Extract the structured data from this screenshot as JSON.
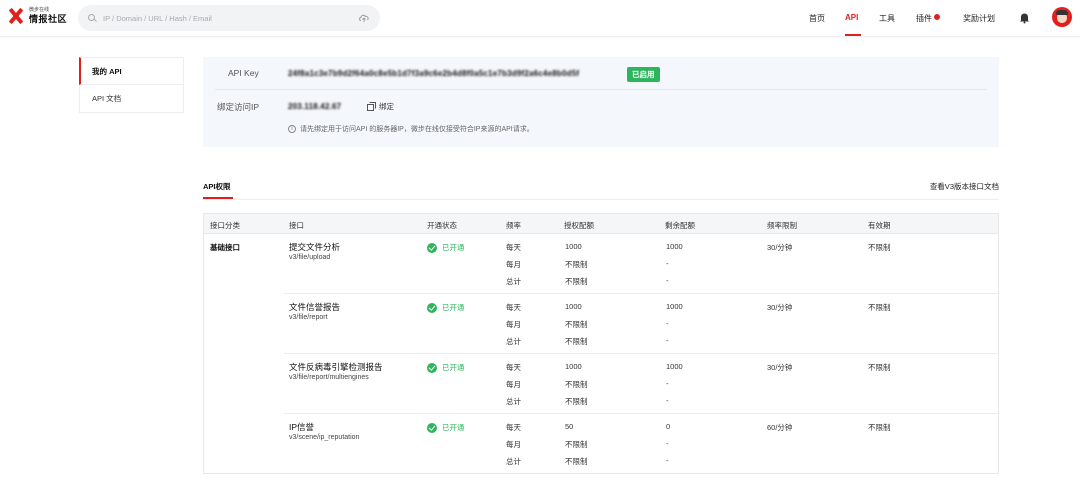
{
  "header": {
    "logo_small": "微步在线",
    "logo_big": "情报社区",
    "search_placeholder": "IP / Domain / URL / Hash / Email",
    "nav": [
      "首页",
      "API",
      "工具",
      "插件",
      "奖励计划"
    ],
    "accent": "#e0201c"
  },
  "sidebar": {
    "items": [
      "我的 API",
      "API 文档"
    ]
  },
  "key_panel": {
    "api_key_label": "API Key",
    "api_key_value": "24f8a1c3e7b9d2f64a0c8e5b1d7f3a9c6e2b4d8f0a5c1e7b3d9f2a6c4e8b0d5f",
    "status_badge": "已启用",
    "ip_label": "绑定访问IP",
    "ip_value": "203.118.42.67",
    "bind_label": "绑定",
    "hint": "请先绑定用于访问API 的服务器IP，微步在线仅接受符合IP来源的API请求。"
  },
  "tabs": {
    "active": "API权限",
    "doc_link": "查看V3版本接口文档"
  },
  "table": {
    "headers": [
      "接口分类",
      "接口",
      "开通状态",
      "频率",
      "授权配额",
      "剩余配额",
      "频率限制",
      "有效期"
    ],
    "category": "基础接口",
    "rows": [
      {
        "name": "提交文件分析",
        "path": "v3/file/upload",
        "status": "已开通",
        "periods": [
          "每天",
          "每月",
          "总计"
        ],
        "quota": [
          "1000",
          "不限制",
          "不限制"
        ],
        "remaining": [
          "1000",
          "-",
          "-"
        ],
        "rate": "30/分钟",
        "validity": "不限制"
      },
      {
        "name": "文件信誉报告",
        "path": "v3/file/report",
        "status": "已开通",
        "periods": [
          "每天",
          "每月",
          "总计"
        ],
        "quota": [
          "1000",
          "不限制",
          "不限制"
        ],
        "remaining": [
          "1000",
          "-",
          "-"
        ],
        "rate": "30/分钟",
        "validity": "不限制"
      },
      {
        "name": "文件反病毒引擎检测报告",
        "path": "v3/file/report/multiengines",
        "status": "已开通",
        "periods": [
          "每天",
          "每月",
          "总计"
        ],
        "quota": [
          "1000",
          "不限制",
          "不限制"
        ],
        "remaining": [
          "1000",
          "-",
          "-"
        ],
        "rate": "30/分钟",
        "validity": "不限制"
      },
      {
        "name": "IP信誉",
        "path": "v3/scene/ip_reputation",
        "status": "已开通",
        "periods": [
          "每天",
          "每月",
          "总计"
        ],
        "quota": [
          "50",
          "不限制",
          "不限制"
        ],
        "remaining": [
          "0",
          "-",
          "-"
        ],
        "rate": "60/分钟",
        "validity": "不限制"
      }
    ]
  }
}
